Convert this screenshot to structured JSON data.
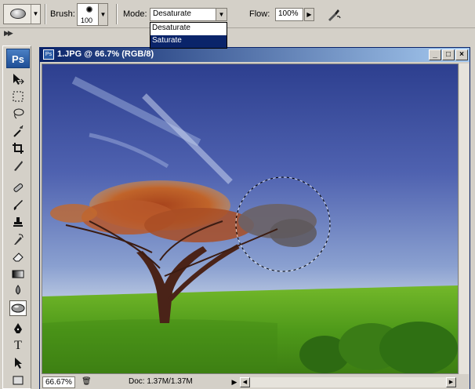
{
  "options_bar": {
    "brush_label": "Brush:",
    "brush_size": "100",
    "mode_label": "Mode:",
    "mode_value": "Desaturate",
    "mode_options": [
      "Desaturate",
      "Saturate"
    ],
    "flow_label": "Flow:",
    "flow_value": "100%"
  },
  "toolbox": {
    "logo": "Ps",
    "type_tool_glyph": "T"
  },
  "document": {
    "title": "1.JPG @ 66.7% (RGB/8)",
    "zoom": "66.67%",
    "doc_info": "Doc: 1.37M/1.37M"
  },
  "colors": {
    "title_gradient_start": "#0a246a",
    "title_gradient_end": "#a6caf0",
    "selection": "#0a246a",
    "chrome": "#d4d0c8"
  }
}
